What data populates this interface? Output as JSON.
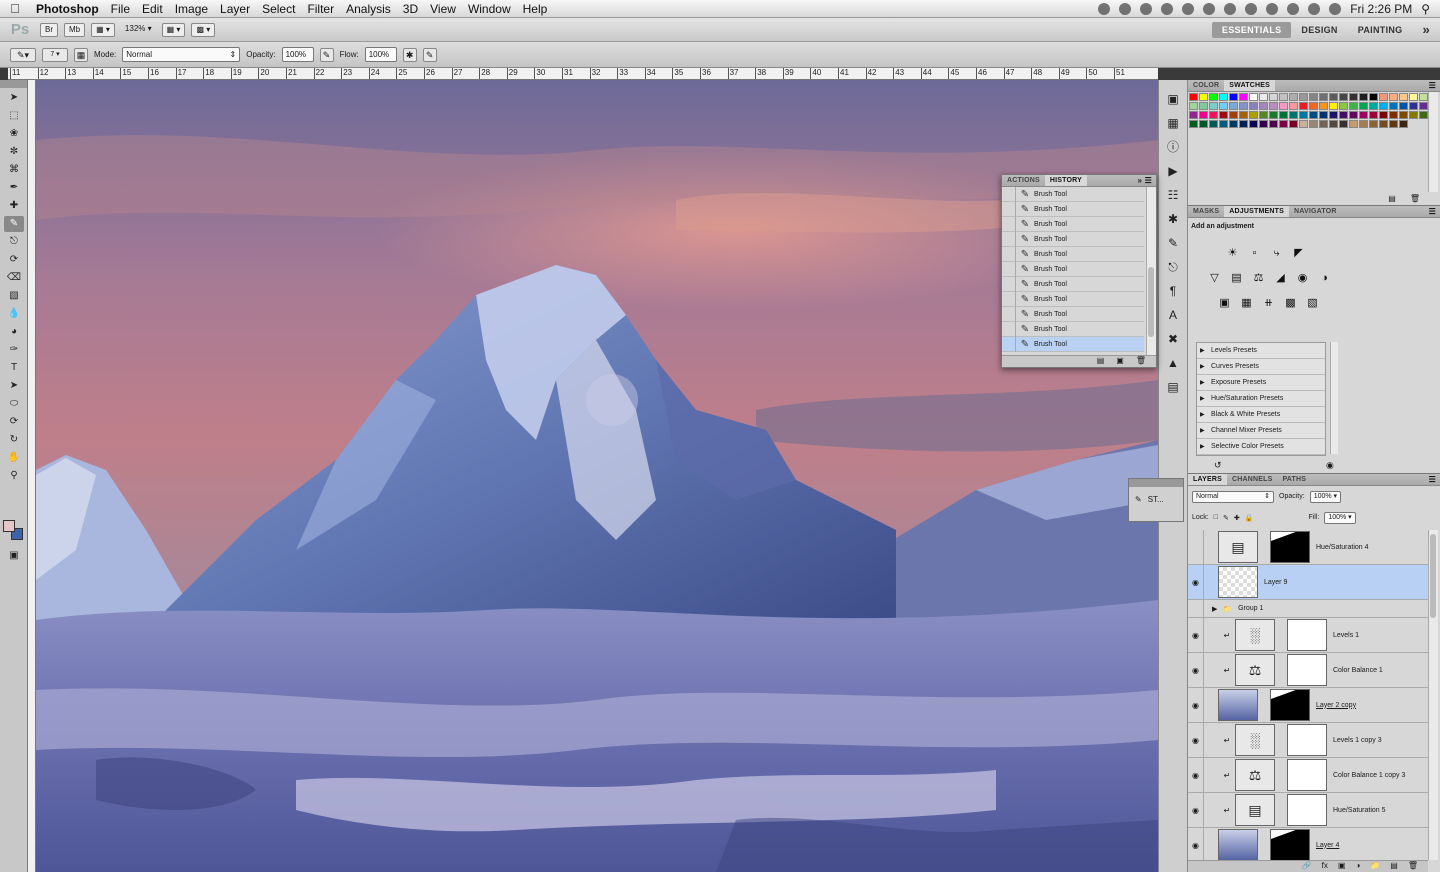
{
  "menubar": {
    "apple": "",
    "app": "Photoshop",
    "items": [
      "File",
      "Edit",
      "Image",
      "Layer",
      "Select",
      "Filter",
      "Analysis",
      "3D",
      "View",
      "Window",
      "Help"
    ],
    "clock": "Fri 2:26 PM"
  },
  "appbar": {
    "logo": "Ps",
    "btn_bridge": "Br",
    "btn_minibridge": "Mb",
    "zoom": "132%",
    "workspaces": [
      "ESSENTIALS",
      "DESIGN",
      "PAINTING"
    ],
    "more": "»"
  },
  "options": {
    "brush_size": "7",
    "mode_label": "Mode:",
    "mode_value": "Normal",
    "opacity_label": "Opacity:",
    "opacity_value": "100%",
    "flow_label": "Flow:",
    "flow_value": "100%"
  },
  "ruler_ticks": [
    "11",
    "12",
    "13",
    "14",
    "15",
    "16",
    "17",
    "18",
    "19",
    "20",
    "21",
    "22",
    "23",
    "24",
    "25",
    "26",
    "27",
    "28",
    "29",
    "30",
    "31",
    "32",
    "33",
    "34",
    "35",
    "36",
    "37",
    "38",
    "39",
    "40",
    "41",
    "42",
    "43",
    "44",
    "45",
    "46",
    "47",
    "48",
    "49",
    "50",
    "51"
  ],
  "history_panel": {
    "tabs": [
      "ACTIONS",
      "HISTORY"
    ],
    "active_tab": "HISTORY",
    "rows": [
      "Brush Tool",
      "Brush Tool",
      "Brush Tool",
      "Brush Tool",
      "Brush Tool",
      "Brush Tool",
      "Brush Tool",
      "Brush Tool",
      "Brush Tool",
      "Brush Tool",
      "Brush Tool"
    ],
    "selected_index": 10
  },
  "styles_panel": {
    "label": "ST..."
  },
  "color_panel": {
    "tabs": [
      "COLOR",
      "SWATCHES"
    ],
    "active_tab": "SWATCHES"
  },
  "adjustments_panel": {
    "tabs": [
      "MASKS",
      "ADJUSTMENTS",
      "NAVIGATOR"
    ],
    "active_tab": "ADJUSTMENTS",
    "title": "Add an adjustment",
    "presets": [
      "Levels Presets",
      "Curves Presets",
      "Exposure Presets",
      "Hue/Saturation Presets",
      "Black & White Presets",
      "Channel Mixer Presets",
      "Selective Color Presets"
    ]
  },
  "layers_panel": {
    "tabs": [
      "LAYERS",
      "CHANNELS",
      "PATHS"
    ],
    "active_tab": "LAYERS",
    "blend_mode": "Normal",
    "opacity_label": "Opacity:",
    "opacity_value": "100%",
    "lock_label": "Lock:",
    "fill_label": "Fill:",
    "fill_value": "100%",
    "layers": [
      {
        "name": "Hue/Saturation 4",
        "visible": false
      },
      {
        "name": "Layer 9",
        "visible": true,
        "selected": true
      },
      {
        "name": "Group 1",
        "visible": false,
        "group": true
      },
      {
        "name": "Levels 1",
        "visible": true
      },
      {
        "name": "Color Balance 1",
        "visible": true
      },
      {
        "name": "Layer 2 copy",
        "visible": true
      },
      {
        "name": "Levels 1 copy 3",
        "visible": true
      },
      {
        "name": "Color Balance 1 copy 3",
        "visible": true
      },
      {
        "name": "Hue/Saturation 5",
        "visible": true
      },
      {
        "name": "Layer 4",
        "visible": true
      }
    ]
  },
  "colors": {
    "selection_blue": "#b7d0f4",
    "panel_gray": "#d7d7d7",
    "foreground_swatch": "#e6c6c8",
    "background_swatch": "#3f62a8"
  }
}
